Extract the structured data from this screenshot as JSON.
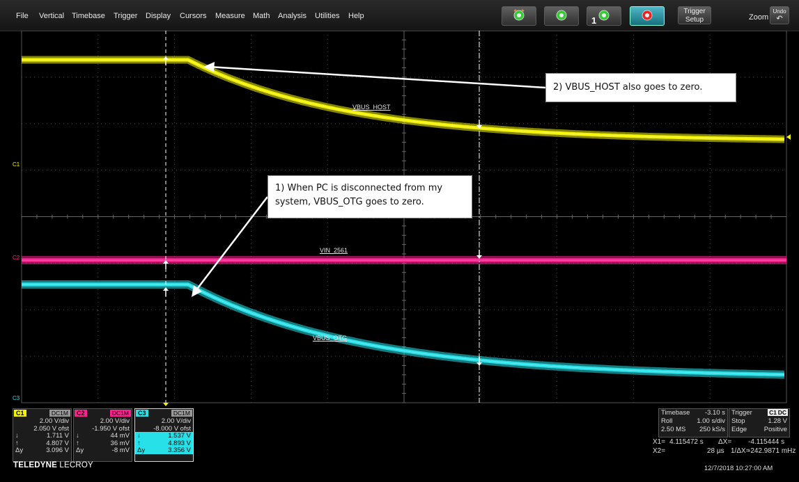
{
  "menu": [
    "File",
    "Vertical",
    "Timebase",
    "Trigger",
    "Display",
    "Cursors",
    "Measure",
    "Math",
    "Analysis",
    "Utilities",
    "Help"
  ],
  "toolbar": {
    "trigger_modes": [
      "auto",
      "normal",
      "single",
      "stop"
    ],
    "single_badge": "1",
    "trigger_setup_line1": "Trigger",
    "trigger_setup_line2": "Setup",
    "zoom": "Zoom",
    "undo": "Undo"
  },
  "annotations": {
    "note2": "2) VBUS_HOST also goes to zero.",
    "note1": "1) When PC is disconnected from my system, VBUS_OTG goes to zero."
  },
  "trace_labels": {
    "c1": "VBUS_HOST",
    "c2": "VIN_2561",
    "c3": "VBUS_OTG"
  },
  "channel_markers": {
    "c1": "C1",
    "c2": "C2",
    "c3": "C3"
  },
  "channels": [
    {
      "tag": "C1",
      "coupling": "DC1M",
      "color": "#f2f200",
      "vdiv": "2.00 V/div",
      "offset": "2.050 V ofst",
      "down_val": "1.711 V",
      "up_val": "4.807 V",
      "dy_label": "Δy",
      "dy": "3.096 V"
    },
    {
      "tag": "C2",
      "coupling": "DC1M",
      "color": "#ff1f8f",
      "vdiv": "2.00 V/div",
      "offset": "-1.950 V ofst",
      "down_val": "44 mV",
      "up_val": "36 mV",
      "dy_label": "Δy",
      "dy": "-8 mV"
    },
    {
      "tag": "C3",
      "coupling": "DC1M",
      "color": "#27e0e8",
      "vdiv": "2.00 V/div",
      "offset": "-8.000 V ofst",
      "down_val": "1.537 V",
      "up_val": "4.893 V",
      "dy_label": "Δy",
      "dy": "3.356 V"
    }
  ],
  "timebase": {
    "label": "Timebase",
    "value": "-3.10 s",
    "mode": "Roll",
    "tdiv": "1.00 s/div",
    "rate_pts": "2.50 MS",
    "rate": "250 kS/s"
  },
  "trigger": {
    "label": "Trigger",
    "src": "C1",
    "coup": "DC",
    "mode": "Stop",
    "level": "1.28 V",
    "type": "Edge",
    "slope": "Positive"
  },
  "cursors": {
    "x1_label": "X1=",
    "x1": "4.115472 s",
    "dx_label": "ΔX=",
    "dx": "-4.115444 s",
    "x2_label": "X2=",
    "x2": "28 µs",
    "inv_label": "1/ΔX=",
    "inv": "-242.9871 mHz"
  },
  "brand": {
    "bold": "TELEDYNE",
    "light": "LECROY"
  },
  "datetime": "12/7/2018 10:27:00 AM",
  "colors": {
    "c1": "#f2f200",
    "c2": "#ff1f8f",
    "c3": "#27e0e8",
    "grid": "#444444",
    "cursor": "#ffffff"
  }
}
